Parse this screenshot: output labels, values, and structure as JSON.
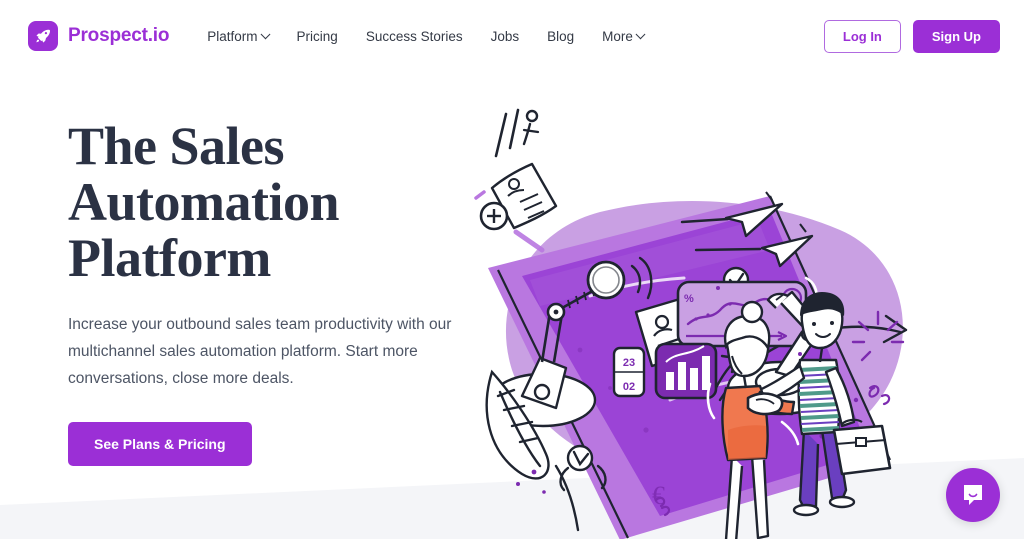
{
  "brand": {
    "name": "Prospect.io",
    "logo_icon": "rocket-icon",
    "accent_color": "#9b2fd6",
    "heading_color": "#2b3244"
  },
  "header": {
    "nav": [
      {
        "label": "Platform",
        "has_dropdown": true
      },
      {
        "label": "Pricing",
        "has_dropdown": false
      },
      {
        "label": "Success Stories",
        "has_dropdown": false
      },
      {
        "label": "Jobs",
        "has_dropdown": false
      },
      {
        "label": "Blog",
        "has_dropdown": false
      },
      {
        "label": "More",
        "has_dropdown": true
      }
    ],
    "login_label": "Log In",
    "signup_label": "Sign Up"
  },
  "hero": {
    "title_line_1": "The Sales",
    "title_line_2": "Automation",
    "title_line_3": "Platform",
    "subtitle": "Increase your outbound sales team productivity with our multichannel sales automation platform. Start more conversations, close more deals.",
    "cta_label": "See Plans & Pricing",
    "illustration": {
      "name": "sales-automation-illustration",
      "description": "Hand-drawn illustration of a purple conveyor belt with robotic arms processing contact cards and dashboards, two people shaking hands, paper airplanes and plants",
      "blob_color": "#c9a0e3",
      "belt_color": "#9b44d6",
      "belt_color_light": "#b977e0",
      "ink_color": "#1f2430",
      "skin_accent": "#f0784f",
      "shirt_accent": "#4f9a8a"
    }
  },
  "bottom_section": {
    "band_color": "#f4f5f8"
  },
  "chat": {
    "icon": "chat-bubble-icon",
    "color": "#9b2fd6"
  }
}
